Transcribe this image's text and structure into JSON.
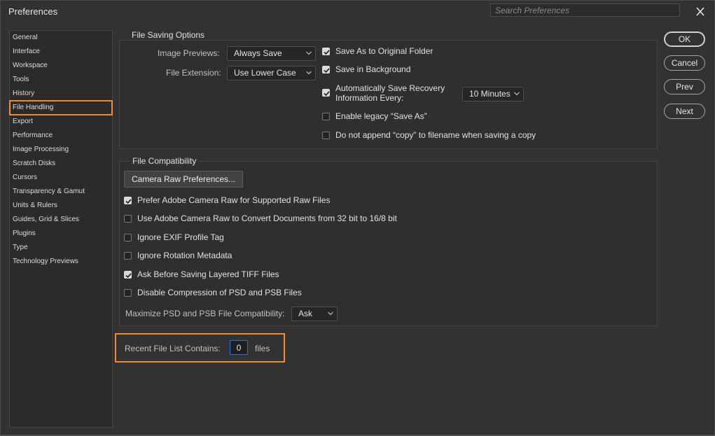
{
  "window": {
    "title": "Preferences"
  },
  "search": {
    "placeholder": "Search Preferences"
  },
  "sidebar": {
    "items": [
      {
        "label": "General"
      },
      {
        "label": "Interface"
      },
      {
        "label": "Workspace"
      },
      {
        "label": "Tools"
      },
      {
        "label": "History"
      },
      {
        "label": "File Handling",
        "selected": true
      },
      {
        "label": "Export"
      },
      {
        "label": "Performance"
      },
      {
        "label": "Image Processing"
      },
      {
        "label": "Scratch Disks"
      },
      {
        "label": "Cursors"
      },
      {
        "label": "Transparency & Gamut"
      },
      {
        "label": "Units & Rulers"
      },
      {
        "label": "Guides, Grid & Slices"
      },
      {
        "label": "Plugins"
      },
      {
        "label": "Type"
      },
      {
        "label": "Technology Previews"
      }
    ]
  },
  "file_saving": {
    "title": "File Saving Options",
    "image_previews_label": "Image Previews:",
    "image_previews_value": "Always Save",
    "file_extension_label": "File Extension:",
    "file_extension_value": "Use Lower Case",
    "save_as_original": {
      "label": "Save As to Original Folder",
      "checked": true
    },
    "save_in_background": {
      "label": "Save in Background",
      "checked": true
    },
    "auto_save": {
      "label_line1": "Automatically Save Recovery",
      "label_line2": "Information Every:",
      "checked": true,
      "interval": "10 Minutes"
    },
    "legacy_save_as": {
      "label": "Enable legacy “Save As”",
      "checked": false
    },
    "no_append_copy": {
      "label": "Do not append “copy” to filename when saving a copy",
      "checked": false
    }
  },
  "file_compat": {
    "title": "File Compatibility",
    "camera_raw_button": "Camera Raw Preferences...",
    "prefer_acr": {
      "label": "Prefer Adobe Camera Raw for Supported Raw Files",
      "checked": true
    },
    "use_acr_convert": {
      "label": "Use Adobe Camera Raw to Convert Documents from 32 bit to 16/8 bit",
      "checked": false
    },
    "ignore_exif": {
      "label": "Ignore EXIF Profile Tag",
      "checked": false
    },
    "ignore_rotation": {
      "label": "Ignore Rotation Metadata",
      "checked": false
    },
    "ask_tiff": {
      "label": "Ask Before Saving Layered TIFF Files",
      "checked": true
    },
    "disable_compression": {
      "label": "Disable Compression of PSD and PSB Files",
      "checked": false
    },
    "maximize_label": "Maximize PSD and PSB File Compatibility:",
    "maximize_value": "Ask"
  },
  "recent_files": {
    "label": "Recent File List Contains:",
    "value": "0",
    "suffix": "files"
  },
  "buttons": {
    "ok": "OK",
    "cancel": "Cancel",
    "prev": "Prev",
    "next": "Next"
  },
  "colors": {
    "highlight": "#f28c28",
    "focus": "#2c6fd1"
  }
}
